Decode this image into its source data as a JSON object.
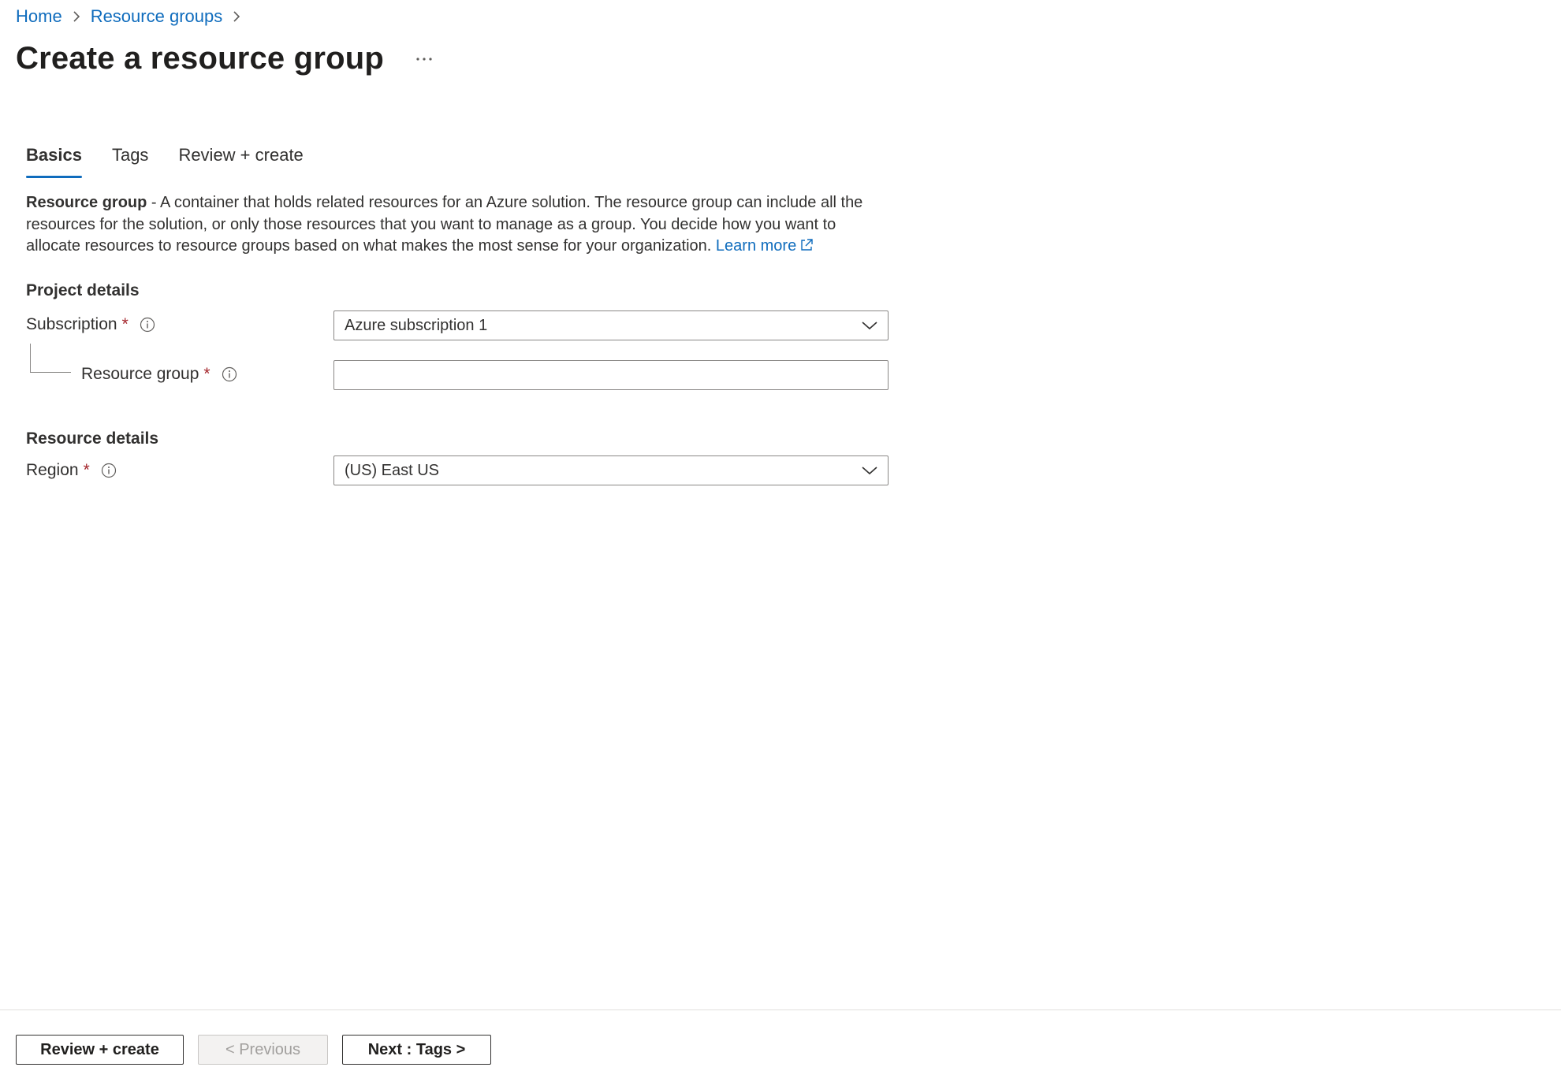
{
  "breadcrumb": {
    "home": "Home",
    "resource_groups": "Resource groups"
  },
  "page": {
    "title": "Create a resource group",
    "more_label": "···"
  },
  "tabs": [
    {
      "label": "Basics",
      "active": true
    },
    {
      "label": "Tags",
      "active": false
    },
    {
      "label": "Review + create",
      "active": false
    }
  ],
  "description": {
    "bold": "Resource group",
    "text": " - A container that holds related resources for an Azure solution. The resource group can include all the resources for the solution, or only those resources that you want to manage as a group. You decide how you want to allocate resources to resource groups based on what makes the most sense for your organization. ",
    "learn_more": "Learn more"
  },
  "project_details": {
    "heading": "Project details",
    "subscription": {
      "label": "Subscription",
      "required": "*",
      "value": "Azure subscription 1"
    },
    "resource_group": {
      "label": "Resource group",
      "required": "*",
      "value": "",
      "placeholder": ""
    }
  },
  "resource_details": {
    "heading": "Resource details",
    "region": {
      "label": "Region",
      "required": "*",
      "value": "(US) East US"
    }
  },
  "footer": {
    "review_create": "Review + create",
    "previous": "< Previous",
    "next": "Next : Tags >"
  },
  "colors": {
    "accent": "#0f6cbd",
    "required": "#a4262c",
    "text": "#323130",
    "border": "#8a8886"
  },
  "icons": [
    "chevron-right-icon",
    "more-icon",
    "external-link-icon",
    "info-icon",
    "chevron-down-icon"
  ]
}
